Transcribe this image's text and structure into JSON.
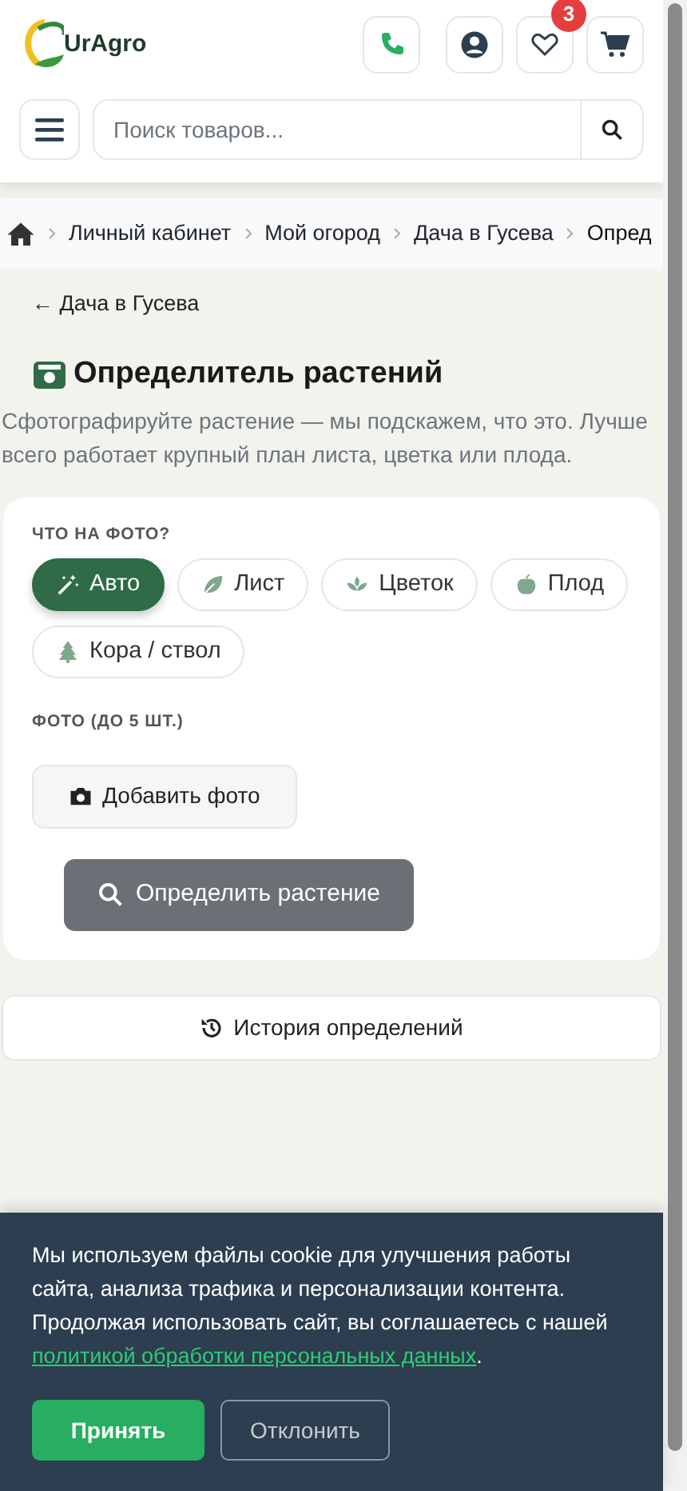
{
  "header": {
    "logo_text": "UrAgro",
    "wishlist_count": "3",
    "search": {
      "placeholder": "Поиск товаров..."
    }
  },
  "breadcrumb": [
    {
      "label": "Личный кабинет"
    },
    {
      "label": "Мой огород"
    },
    {
      "label": "Дача в Гусева"
    },
    {
      "label": "Опред"
    }
  ],
  "back_link": "← Дача в Гусева",
  "title": "Определитель растений",
  "description": "Сфотографируйте растение — мы подскажем, что это. Лучше всего работает крупный план листа, цветка или плода.",
  "form": {
    "type_label": "ЧТО НА ФОТО?",
    "types": [
      {
        "label": "Авто",
        "kind": "auto",
        "selected": true
      },
      {
        "label": "Лист",
        "kind": "leaf",
        "selected": false
      },
      {
        "label": "Цветок",
        "kind": "flower",
        "selected": false
      },
      {
        "label": "Плод",
        "kind": "fruit",
        "selected": false
      },
      {
        "label": "Кора / ствол",
        "kind": "tree",
        "selected": false
      }
    ],
    "photo_label": "ФОТО (ДО 5 ШТ.)",
    "add_photo": "Добавить фото",
    "submit": {
      "label": "Определить растение",
      "disabled": true
    }
  },
  "history_button": "История определений",
  "cookie": {
    "text": "Мы используем файлы cookie для улучшения работы сайта, анализа трафика и персонализации контента. Продолжая использовать сайт, вы соглашаетесь с нашей ",
    "link": "политикой обработки персональных данных",
    "text_after": ".",
    "accept": "Принять",
    "decline": "Отклонить"
  }
}
